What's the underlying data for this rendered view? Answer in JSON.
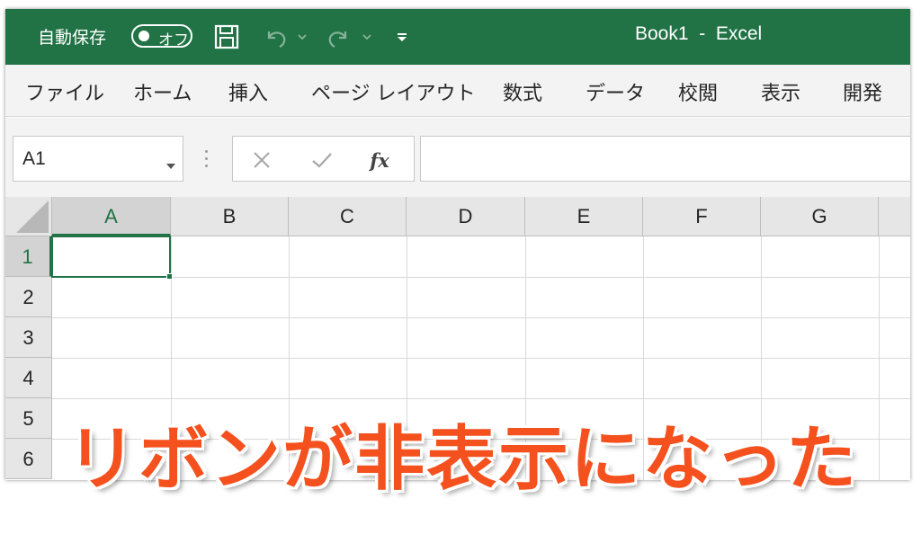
{
  "titlebar": {
    "autosave_label": "自動保存",
    "autosave_state": "オフ",
    "title": "Book1  -  Excel",
    "bg_color": "#217346",
    "icons": [
      "save-icon",
      "undo-icon",
      "chevron-down-icon",
      "redo-icon",
      "chevron-down-icon",
      "customize-qat-icon"
    ]
  },
  "tabs": [
    {
      "label": "ファイル"
    },
    {
      "label": "ホーム"
    },
    {
      "label": "挿入"
    },
    {
      "label": "ページ レイアウト"
    },
    {
      "label": "数式"
    },
    {
      "label": "データ"
    },
    {
      "label": "校閲"
    },
    {
      "label": "表示"
    },
    {
      "label": "開発"
    }
  ],
  "formula_bar": {
    "name_box": "A1",
    "fx_label": "fx",
    "formula_value": ""
  },
  "grid": {
    "columns": [
      "A",
      "B",
      "C",
      "D",
      "E",
      "F",
      "G"
    ],
    "rows": [
      "1",
      "2",
      "3",
      "4",
      "5",
      "6"
    ],
    "active_cell": "A1",
    "accent_color": "#217346"
  },
  "caption": {
    "text": "リボンが非表示になった",
    "color": "#f4511e"
  }
}
